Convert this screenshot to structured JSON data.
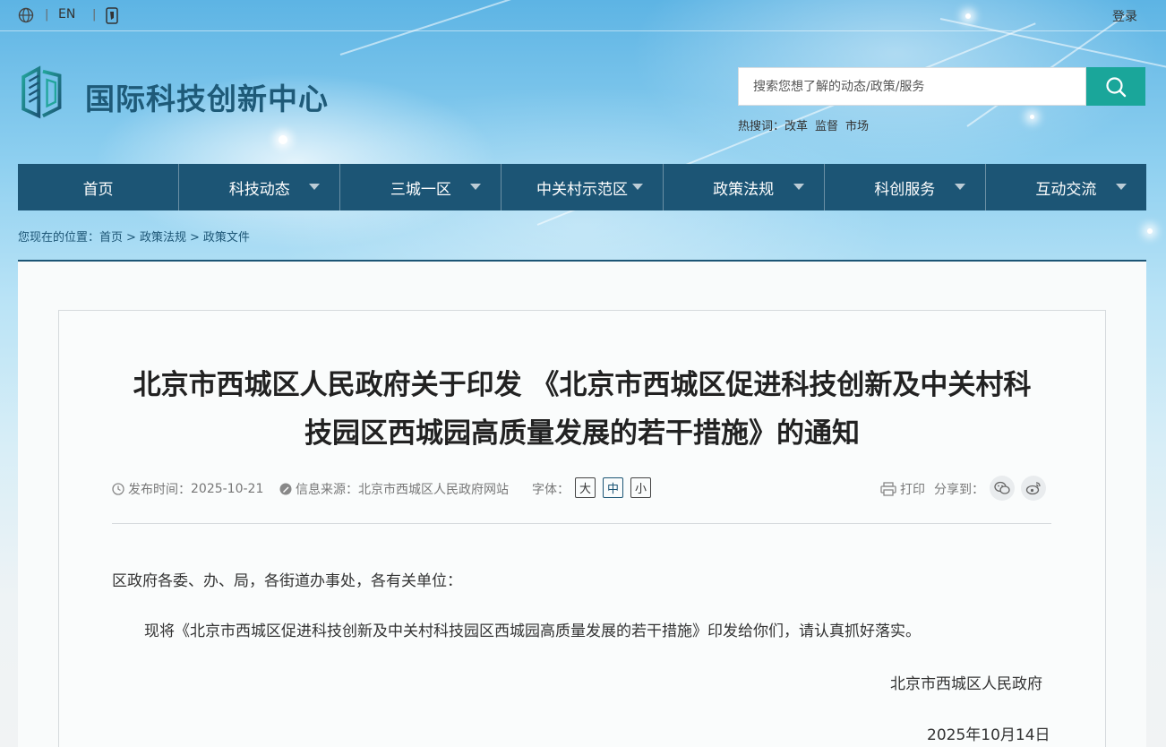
{
  "topbar": {
    "language": "EN",
    "login": "登录"
  },
  "logo": {
    "text": "国际科技创新中心"
  },
  "search": {
    "placeholder": "搜索您想了解的动态/政策/服务",
    "hot_label": "热搜词：",
    "hot_words": [
      "改革",
      "监督",
      "市场"
    ]
  },
  "nav": {
    "items": [
      {
        "label": "首页",
        "dropdown": false
      },
      {
        "label": "科技动态",
        "dropdown": true
      },
      {
        "label": "三城一区",
        "dropdown": true
      },
      {
        "label": "中关村示范区",
        "dropdown": true
      },
      {
        "label": "政策法规",
        "dropdown": true
      },
      {
        "label": "科创服务",
        "dropdown": true
      },
      {
        "label": "互动交流",
        "dropdown": true
      }
    ]
  },
  "breadcrumb": {
    "label": "您现在的位置：",
    "items": [
      "首页",
      "政策法规",
      "政策文件"
    ],
    "separator": ">"
  },
  "article": {
    "title_line1": "北京市西城区人民政府关于印发 《北京市西城区促进科技创新及中关村科",
    "title_line2": "技园区西城园高质量发展的若干措施》的通知",
    "publish_label": "发布时间：",
    "publish_date": "2025-10-21",
    "source_label": "信息来源：",
    "source": "北京市西城区人民政府网站",
    "font_label": "字体：",
    "font_sizes": [
      "大",
      "中",
      "小"
    ],
    "print": "打印",
    "share_label": "分享到：",
    "salutation": "区政府各委、办、局，各街道办事处，各有关单位：",
    "body": "现将《北京市西城区促进科技创新及中关村科技园区西城园高质量发展的若干措施》印发给你们，请认真抓好落实。",
    "signature": "北京市西城区人民政府",
    "date": "2025年10月14日"
  },
  "colors": {
    "nav_bg": "#1c5575",
    "search_button": "#1aa69a",
    "logo_text": "#1e5a78"
  }
}
